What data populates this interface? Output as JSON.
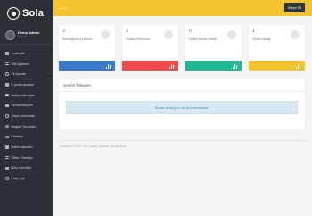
{
  "brand": {
    "name": "Sola"
  },
  "user": {
    "name": "Demo Admin",
    "role": "Yönetici"
  },
  "menu": [
    {
      "label": "Anasayfa",
      "icon": "home-icon",
      "shape": "sq"
    },
    {
      "label": "Site Ayarları",
      "icon": "settings-icon",
      "shape": "ln"
    },
    {
      "label": "Ek Ayarlar",
      "icon": "gear-icon",
      "shape": "ci",
      "arrow": "›"
    },
    {
      "label": "E-posta Ayarları",
      "icon": "mail-icon",
      "shape": "sq"
    },
    {
      "label": "İletişim Mesajları",
      "icon": "message-icon",
      "shape": "sq"
    },
    {
      "label": "Servis Talepleri",
      "icon": "ticket-icon",
      "shape": "sq"
    },
    {
      "label": "Sıkça Sorulanlar",
      "icon": "question-icon",
      "shape": "ci"
    },
    {
      "label": "Müşteri Yorumları",
      "icon": "comment-icon",
      "shape": "ci"
    },
    {
      "label": "Ekibimiz",
      "icon": "team-icon",
      "shape": "ci"
    },
    {
      "label": "Galeri İşlemleri",
      "icon": "image-icon",
      "shape": "sq"
    },
    {
      "label": "Slider Yönetimi",
      "icon": "slider-icon",
      "shape": "ln"
    },
    {
      "label": "Ürün İşlemleri",
      "icon": "box-icon",
      "shape": "sq",
      "arrow": "›"
    },
    {
      "label": "Çıkış Yap",
      "icon": "logout-icon",
      "shape": "ci"
    }
  ],
  "topbar": {
    "back_icon": "arrow-left-icon",
    "site_button": "Siteye Git"
  },
  "cards": [
    {
      "value": "3",
      "label": "Sunduğumuz Hizmet",
      "color": "#3a78c9"
    },
    {
      "value": "3",
      "label": "Toplam Personel",
      "color": "#ef4b4b"
    },
    {
      "value": "0",
      "label": "Gelen Servis Talebi",
      "color": "#23b894"
    },
    {
      "value": "1",
      "label": "Gelen Mesaj",
      "color": "#f5c431"
    }
  ],
  "panel": {
    "title": "Servis Talepleri",
    "empty_message": "Burada herhangi bir veri bulunmamaktadır."
  },
  "footer": {
    "text": "Copyright © 2022. Tüm Hakları Saklıdır. Yüzüncüsoft"
  },
  "colors": {
    "sidebar": "#2b3036",
    "accent": "#f5c431",
    "background": "#f3f4f6"
  }
}
